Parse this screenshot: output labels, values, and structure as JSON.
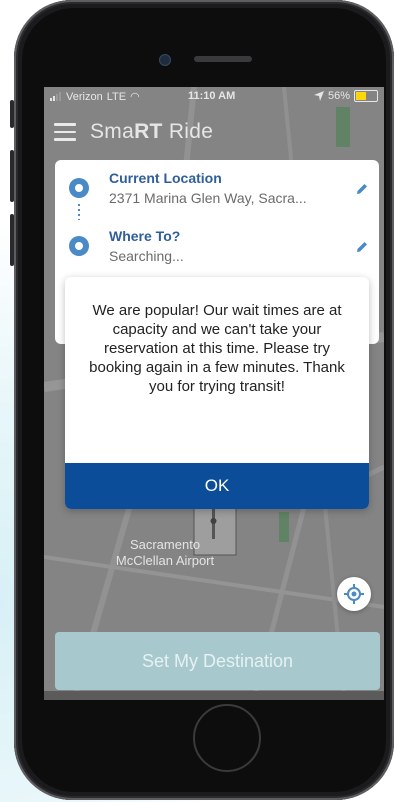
{
  "status_bar": {
    "carrier": "Verizon",
    "network": "LTE",
    "time": "11:10 AM",
    "battery": "56%",
    "battery_level": 0.56
  },
  "app_bar": {
    "brand_prefix": "Sma",
    "brand_bold": "RT",
    "brand_suffix": " Ride"
  },
  "locations": [
    {
      "title": "Current Location",
      "subtitle": "2371 Marina Glen Way, Sacra..."
    },
    {
      "title": "Where To?",
      "subtitle": "Searching..."
    }
  ],
  "dialog": {
    "message": "We are popular! Our wait times are at capacity and we can't take your reservation at this time. Please try booking again in a few minutes. Thank you for trying transit!",
    "ok_label": "OK"
  },
  "map": {
    "airport_label": "Sacramento McClellan Airport"
  },
  "destination_button": "Set My Destination",
  "colors": {
    "primary_blue": "#0b4d98",
    "location_blue": "#2f5f9a",
    "destination_teal": "#a7c9ce"
  }
}
